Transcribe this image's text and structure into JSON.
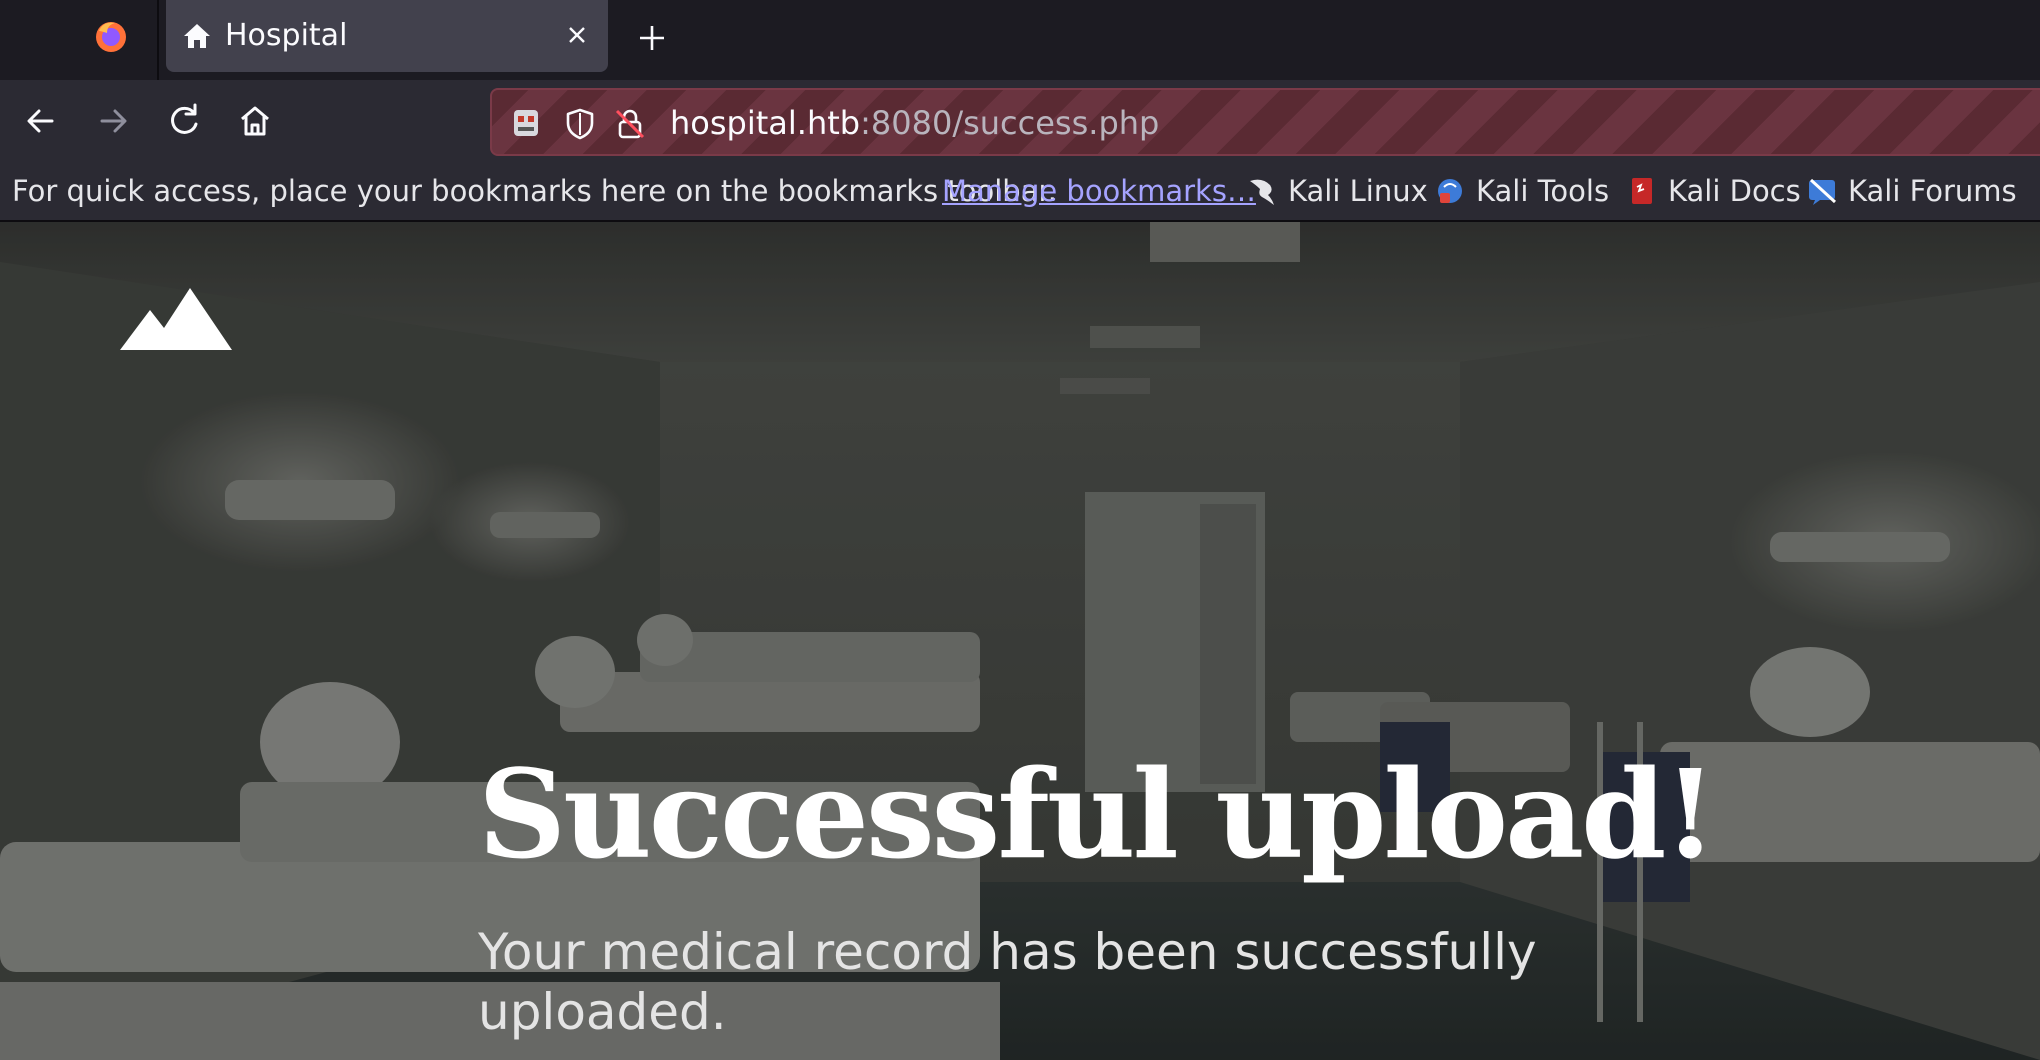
{
  "browser": {
    "tab": {
      "title": "Hospital"
    },
    "url": {
      "host": "hospital.htb",
      "rest": ":8080/success.php"
    },
    "bookmarks": {
      "hint": "For quick access, place your bookmarks here on the bookmarks toolbar.",
      "manage_label": "Manage bookmarks…",
      "items": [
        {
          "label": "Kali Linux",
          "icon": "kali-dragon-icon"
        },
        {
          "label": "Kali Tools",
          "icon": "kali-tools-icon"
        },
        {
          "label": "Kali Docs",
          "icon": "kali-docs-icon"
        },
        {
          "label": "Kali Forums",
          "icon": "kali-forums-icon"
        }
      ]
    },
    "accent_color": "#6a3440"
  },
  "page": {
    "headline": "Successful upload!",
    "message": "Your medical record has been successfully uploaded."
  }
}
